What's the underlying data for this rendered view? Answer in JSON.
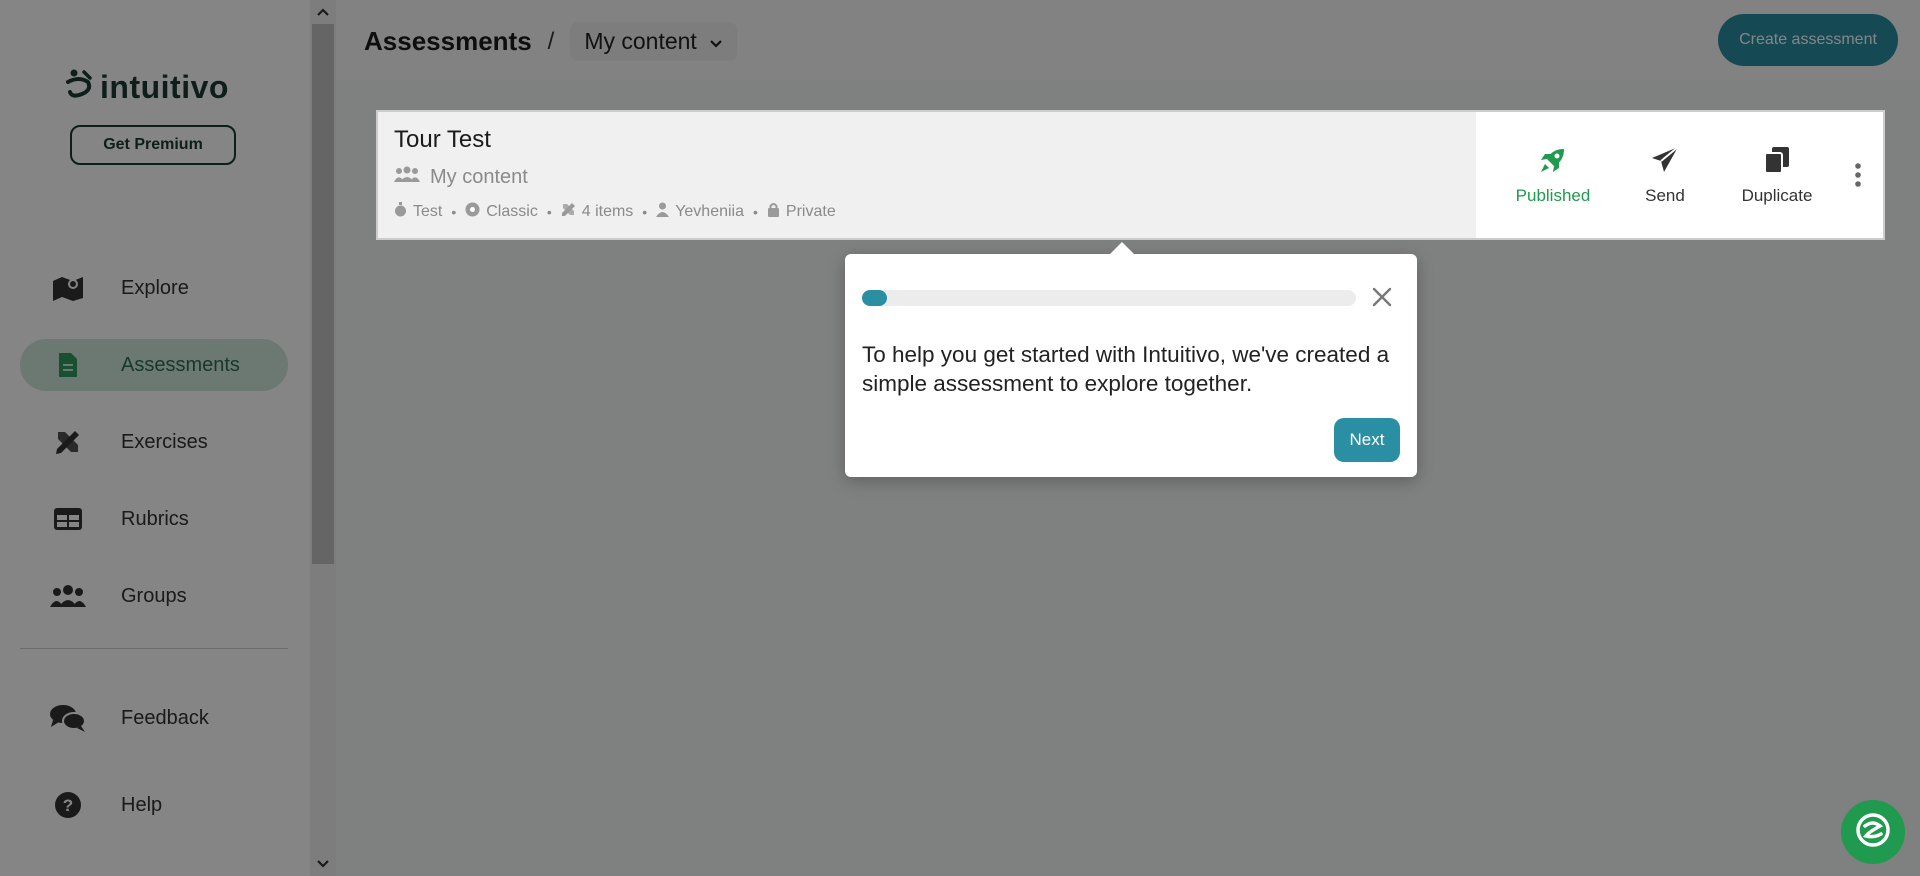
{
  "sidebar": {
    "logo_text": "intuitivo",
    "premium_label": "Get Premium",
    "items": [
      {
        "label": "Explore",
        "icon": "map-icon"
      },
      {
        "label": "Assessments",
        "icon": "document-icon"
      },
      {
        "label": "Exercises",
        "icon": "pencil-ruler-icon"
      },
      {
        "label": "Rubrics",
        "icon": "table-icon"
      },
      {
        "label": "Groups",
        "icon": "users-icon"
      }
    ],
    "bottom_items": [
      {
        "label": "Feedback",
        "icon": "chat-icon"
      },
      {
        "label": "Help",
        "icon": "help-icon"
      }
    ]
  },
  "header": {
    "title": "Assessments",
    "separator": "/",
    "dropdown_value": "My content",
    "create_label": "Create assessment"
  },
  "card": {
    "title": "Tour Test",
    "folder": "My content",
    "meta": [
      "Test",
      "Classic",
      "4 items",
      "Yevheniia",
      "Private"
    ],
    "actions": [
      {
        "label": "Published",
        "icon": "rocket-icon",
        "color": "#1f9a4e"
      },
      {
        "label": "Send",
        "icon": "paper-plane-icon"
      },
      {
        "label": "Duplicate",
        "icon": "copy-icon"
      }
    ]
  },
  "tour": {
    "progress": 0.05,
    "text": "To help you get started with Intuitivo, we've created a simple assessment to explore together.",
    "next_label": "Next"
  },
  "colors": {
    "accent": "#2a8fa3",
    "brand_green": "#1f9a4e",
    "active_nav_bg": "#cfe8dc"
  }
}
